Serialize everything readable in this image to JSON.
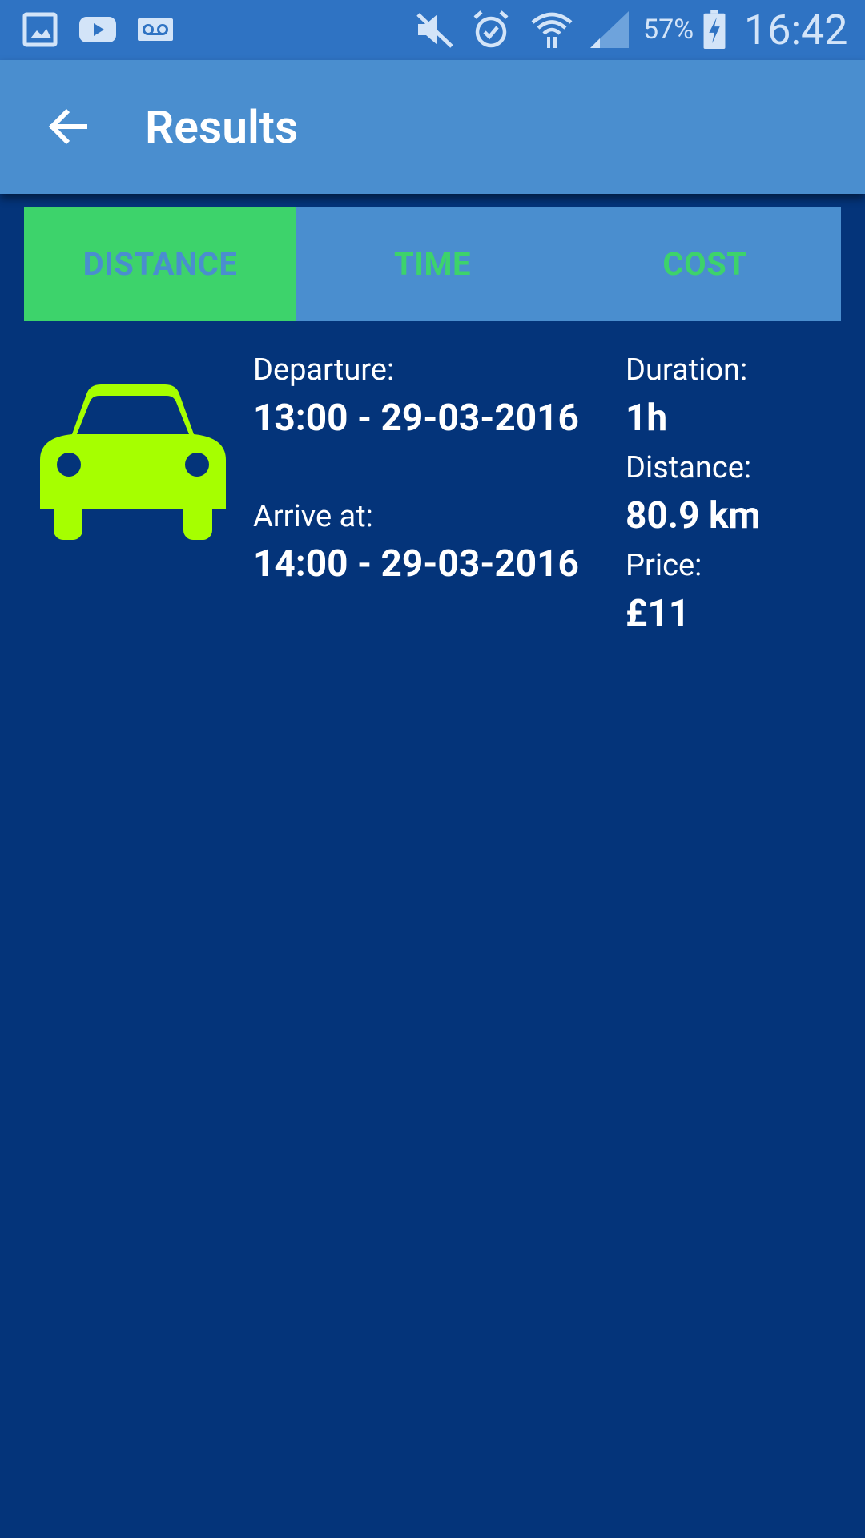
{
  "status_bar": {
    "icons": [
      "gallery-icon",
      "youtube-icon",
      "voicemail-icon",
      "mute-icon",
      "alarm-icon",
      "wifi-icon",
      "signal-icon",
      "battery-charging-icon"
    ],
    "battery_percent": "57%",
    "time": "16:42"
  },
  "app_bar": {
    "title": "Results",
    "back_icon": "arrow-back-icon"
  },
  "tabs": [
    {
      "label": "DISTANCE",
      "active": true
    },
    {
      "label": "TIME",
      "active": false
    },
    {
      "label": "COST",
      "active": false
    }
  ],
  "result": {
    "vehicle_icon": "car-icon",
    "departure_label": "Departure:",
    "departure_value": "13:00 - 29-03-2016",
    "arrive_label": "Arrive at:",
    "arrive_value": "14:00 - 29-03-2016",
    "duration_label": "Duration:",
    "duration_value": "1h",
    "distance_label": "Distance:",
    "distance_value": "80.9 km",
    "price_label": "Price:",
    "price_value": "£11"
  },
  "colors": {
    "background": "#04347a",
    "status_bar": "#2f73c3",
    "app_bar": "#4a8ecf",
    "tab_active": "#3dd36b",
    "car": "#a6ff00"
  }
}
